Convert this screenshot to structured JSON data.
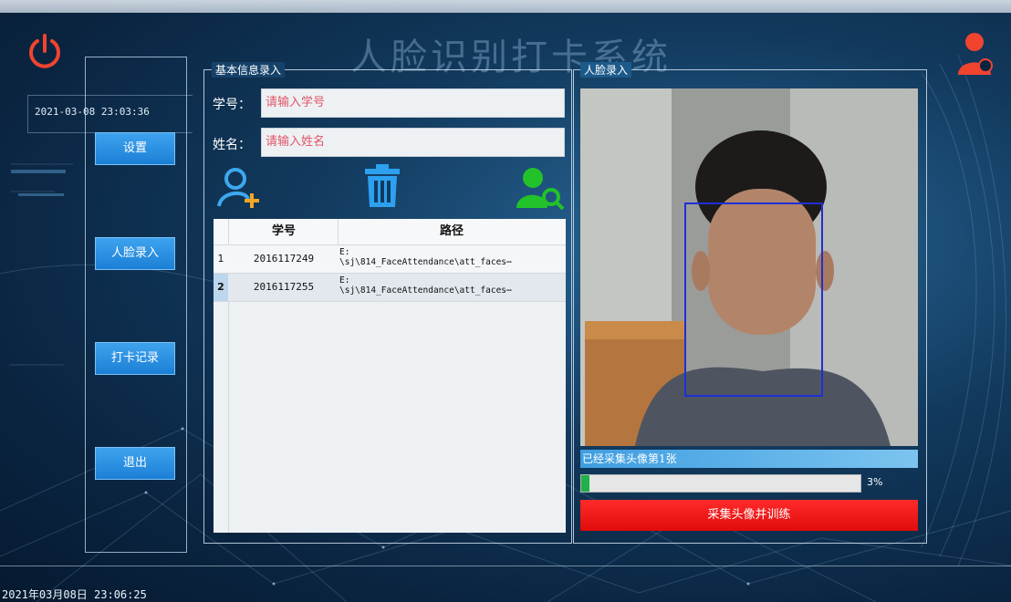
{
  "app": {
    "title": "人脸识别打卡系统",
    "datetime_top": "2021-03-08 23:03:36",
    "datetime_bottom": "2021年03月08日  23:06:25"
  },
  "nav": {
    "settings": "设置",
    "face_enroll": "人脸录入",
    "checkin_records": "打卡记录",
    "exit": "退出"
  },
  "info_group": {
    "label": "基本信息录入",
    "student_id_label": "学号：",
    "student_id_placeholder": "请输入学号",
    "name_label": "姓名：",
    "name_placeholder": "请输入姓名"
  },
  "toolbar_icons": [
    "add-user-icon",
    "trash-icon",
    "search-user-icon"
  ],
  "table": {
    "columns": [
      "学号",
      "路径"
    ],
    "rows": [
      {
        "num": "1",
        "id": "2016117249",
        "path": "E:\n\\sj\\814_FaceAttendance\\att_faces⋯"
      },
      {
        "num": "2",
        "id": "2016117255",
        "path": "E:\n\\sj\\814_FaceAttendance\\att_faces⋯"
      }
    ]
  },
  "face_group": {
    "label": "人脸录入",
    "status": "已经采集头像第1张",
    "progress_fraction": 0.03,
    "progress_text": "3%",
    "capture_button": "采集头像并训练"
  },
  "colors": {
    "accent_blue": "#1b7fd6",
    "red_button": "#e00b0b",
    "progress_green": "#1fb14a"
  }
}
